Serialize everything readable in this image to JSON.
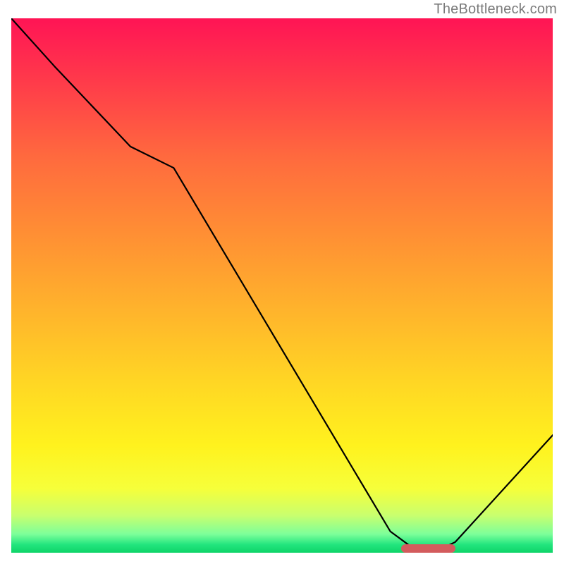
{
  "watermark": "TheBottleneck.com",
  "chart_data": {
    "type": "line",
    "title": "",
    "xlabel": "",
    "ylabel": "",
    "xlim": [
      0,
      100
    ],
    "ylim": [
      0,
      100
    ],
    "x": [
      0,
      8,
      22,
      30,
      70,
      74,
      80,
      82,
      100
    ],
    "values": [
      100,
      91,
      76,
      72,
      4,
      1,
      1,
      2,
      22
    ],
    "optimal_region": {
      "x_start": 72,
      "x_end": 82,
      "y": 0.8
    },
    "gradient_note": "vertical red→orange→yellow→green heatmap; green at bottom"
  }
}
